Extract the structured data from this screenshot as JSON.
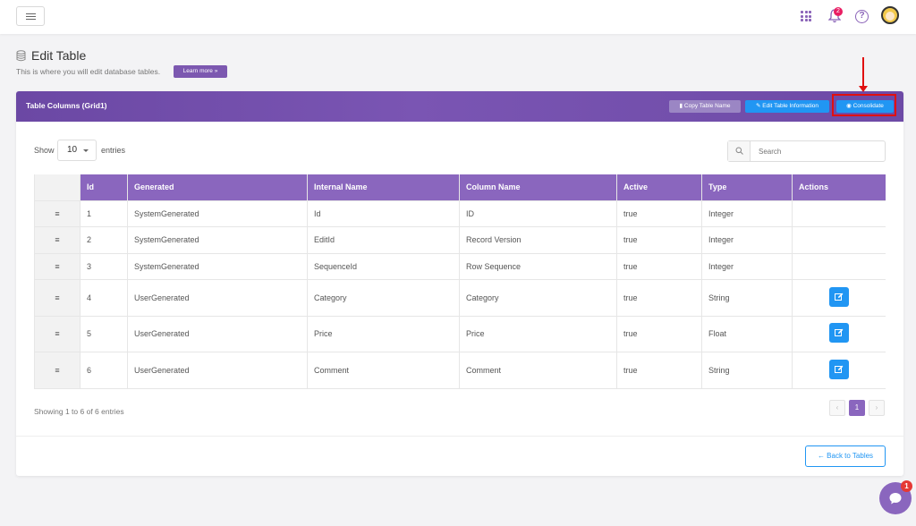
{
  "topbar": {
    "notifications_count": "2",
    "help_glyph": "?"
  },
  "header": {
    "title": "Edit Table",
    "subtitle": "This is where you will edit database tables.",
    "learn_more": "Learn more »"
  },
  "card": {
    "title": "Table Columns (Grid1)",
    "copy_label": "Copy Table Name",
    "edit_label": "Edit Table Information",
    "consolidate_label": "Consolidate"
  },
  "controls": {
    "show_label": "Show",
    "entries_value": "10",
    "entries_label": "entries",
    "search_placeholder": "Search"
  },
  "table": {
    "headers": [
      "",
      "Id",
      "Generated",
      "Internal Name",
      "Column Name",
      "Active",
      "Type",
      "Actions"
    ],
    "rows": [
      {
        "drag": "≡",
        "id": "1",
        "generated": "SystemGenerated",
        "internal": "Id",
        "column": "ID",
        "active": "true",
        "type": "Integer",
        "editable": false
      },
      {
        "drag": "≡",
        "id": "2",
        "generated": "SystemGenerated",
        "internal": "EditId",
        "column": "Record Version",
        "active": "true",
        "type": "Integer",
        "editable": false
      },
      {
        "drag": "≡",
        "id": "3",
        "generated": "SystemGenerated",
        "internal": "SequenceId",
        "column": "Row Sequence",
        "active": "true",
        "type": "Integer",
        "editable": false
      },
      {
        "drag": "≡",
        "id": "4",
        "generated": "UserGenerated",
        "internal": "Category",
        "column": "Category",
        "active": "true",
        "type": "String",
        "editable": true
      },
      {
        "drag": "≡",
        "id": "5",
        "generated": "UserGenerated",
        "internal": "Price",
        "column": "Price",
        "active": "true",
        "type": "Float",
        "editable": true
      },
      {
        "drag": "≡",
        "id": "6",
        "generated": "UserGenerated",
        "internal": "Comment",
        "column": "Comment",
        "active": "true",
        "type": "String",
        "editable": true
      }
    ]
  },
  "footer": {
    "showing": "Showing 1 to 6 of 6 entries",
    "pages": {
      "prev": "‹",
      "current": "1",
      "next": "›"
    },
    "back_label": "← Back to Tables"
  },
  "chat": {
    "badge": "1"
  },
  "colors": {
    "accent_purple": "#8a66be",
    "header_purple": "#6b48a4",
    "button_blue": "#2196f3",
    "annotation_red": "#e01010"
  }
}
